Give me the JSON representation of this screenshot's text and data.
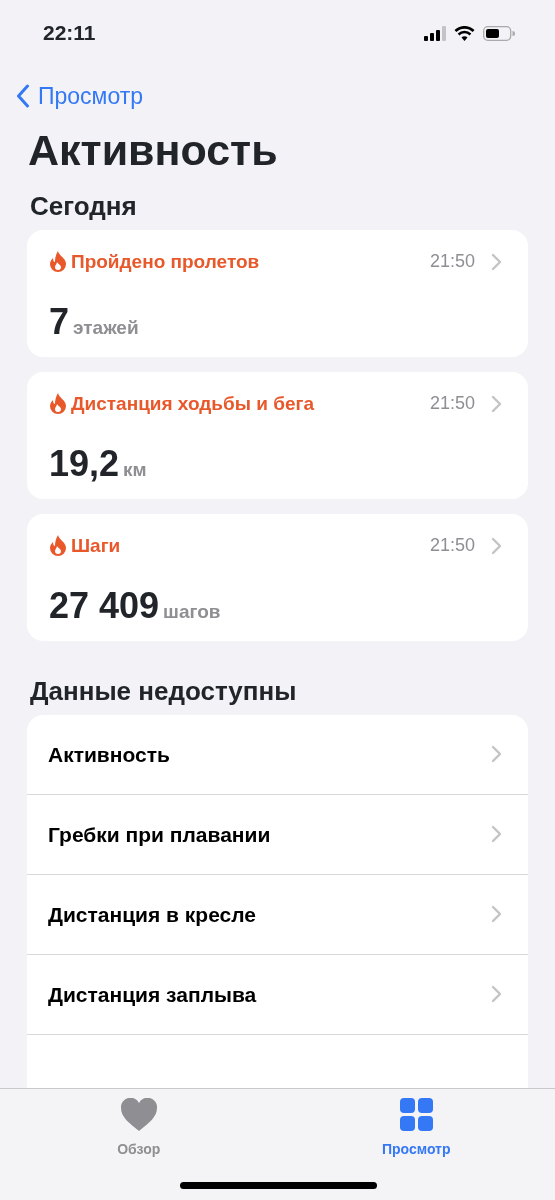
{
  "status_bar": {
    "time": "22:11"
  },
  "nav": {
    "back": "Просмотр"
  },
  "title": "Активность",
  "today": {
    "heading": "Сегодня",
    "cards": [
      {
        "label": "Пройдено пролетов",
        "time": "21:50",
        "value": "7",
        "unit": "этажей"
      },
      {
        "label": "Дистанция ходьбы и бега",
        "time": "21:50",
        "value": "19,2",
        "unit": "км"
      },
      {
        "label": "Шаги",
        "time": "21:50",
        "value": "27 409",
        "unit": "шагов"
      }
    ]
  },
  "unavailable": {
    "heading": "Данные недоступны",
    "items": [
      "Активность",
      "Гребки при плавании",
      "Дистанция в кресле",
      "Дистанция заплыва"
    ]
  },
  "tab_bar": [
    {
      "kind": "heart",
      "label": "Обзор",
      "selected": false
    },
    {
      "kind": "grid",
      "label": "Просмотр",
      "selected": true
    }
  ]
}
